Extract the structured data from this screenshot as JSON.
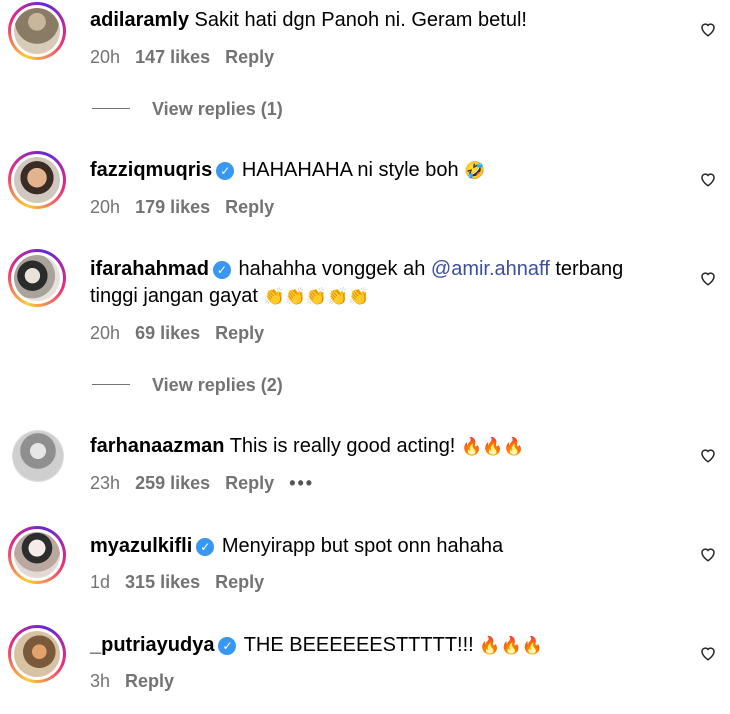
{
  "comments": [
    {
      "username": "adilaramly",
      "text": "Sakit hati dgn Panoh ni. Geram betul!",
      "time": "20h",
      "likes": "147 likes",
      "reply": "Reply",
      "view_replies": "View replies (1)"
    },
    {
      "username": "fazziqmuqris",
      "text": "HAHAHAHA ni style boh",
      "emoji": "🤣",
      "time": "20h",
      "likes": "179 likes",
      "reply": "Reply"
    },
    {
      "username": "ifarahahmad",
      "text_before": "hahahha vonggek ah",
      "mention": "@amir.ahnaff",
      "text_after": "terbang",
      "text_line2": "tinggi jangan gayat",
      "emoji": "👏👏👏👏👏",
      "time": "20h",
      "likes": "69 likes",
      "reply": "Reply",
      "view_replies": "View replies (2)"
    },
    {
      "username": "farhanaazman",
      "text": "This is really good acting!",
      "emoji": "🔥🔥🔥",
      "time": "23h",
      "likes": "259 likes",
      "reply": "Reply",
      "more": "•••"
    },
    {
      "username": "myazulkifli",
      "text": "Menyirapp but spot onn hahaha",
      "time": "1d",
      "likes": "315 likes",
      "reply": "Reply"
    },
    {
      "username": "_putriayudya",
      "text": "THE BEEEEEESTTTTT!!!",
      "emoji": "🔥🔥🔥",
      "time": "3h",
      "reply": "Reply"
    }
  ],
  "icons": {
    "heart": "heart-outline-icon",
    "verified": "verified-badge-icon"
  },
  "colors": {
    "verified": "#3897f0",
    "mention": "#3d4f9c",
    "meta": "#737373"
  }
}
